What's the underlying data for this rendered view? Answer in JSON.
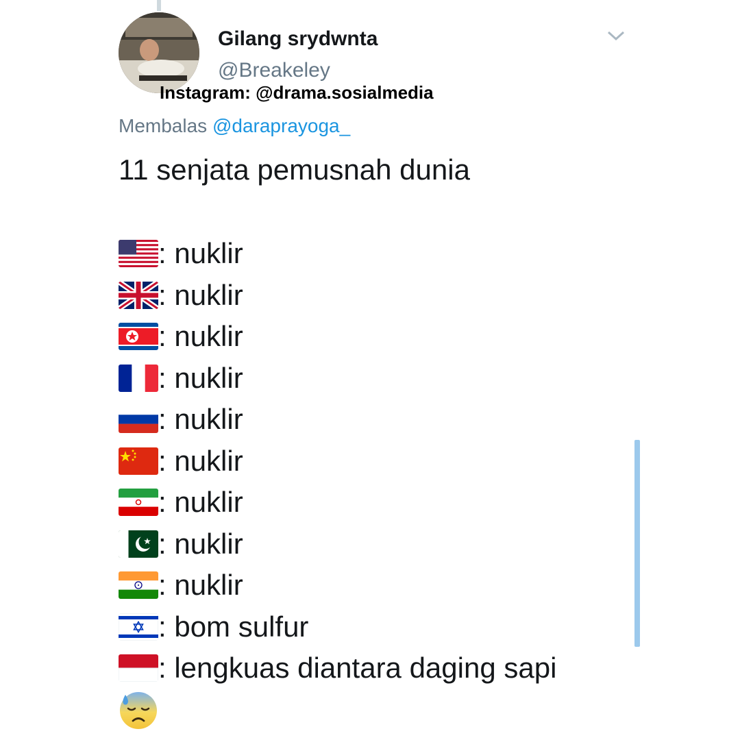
{
  "author": {
    "name": "Gilang srydwnta",
    "handle": "@Breakeley"
  },
  "watermark": "Instagram: @drama.sosialmedia",
  "reply": {
    "prefix": "Membalas",
    "mention": "@daraprayoga_"
  },
  "tweet": {
    "title": "11 senjata pemusnah dunia",
    "rows": [
      {
        "flag": "us-flag",
        "text": ": nuklir"
      },
      {
        "flag": "uk-flag",
        "text": ": nuklir"
      },
      {
        "flag": "north-korea-flag",
        "text": ": nuklir"
      },
      {
        "flag": "france-flag",
        "text": ": nuklir"
      },
      {
        "flag": "russia-flag",
        "text": ": nuklir"
      },
      {
        "flag": "china-flag",
        "text": ": nuklir"
      },
      {
        "flag": "iran-flag",
        "text": ": nuklir"
      },
      {
        "flag": "pakistan-flag",
        "text": ": nuklir"
      },
      {
        "flag": "india-flag",
        "text": ": nuklir"
      },
      {
        "flag": "israel-flag",
        "text": ": bom sulfur"
      },
      {
        "flag": "indonesia-flag",
        "text": ": lengkuas diantara daging sapi"
      }
    ],
    "end_emoji": "anxious-face-with-sweat-icon"
  },
  "icons": {
    "menu": "chevron-down-icon"
  },
  "colors": {
    "link": "#1b95e0",
    "muted": "#657786",
    "text": "#14171a",
    "scrollbar": "#9cc9ec"
  }
}
